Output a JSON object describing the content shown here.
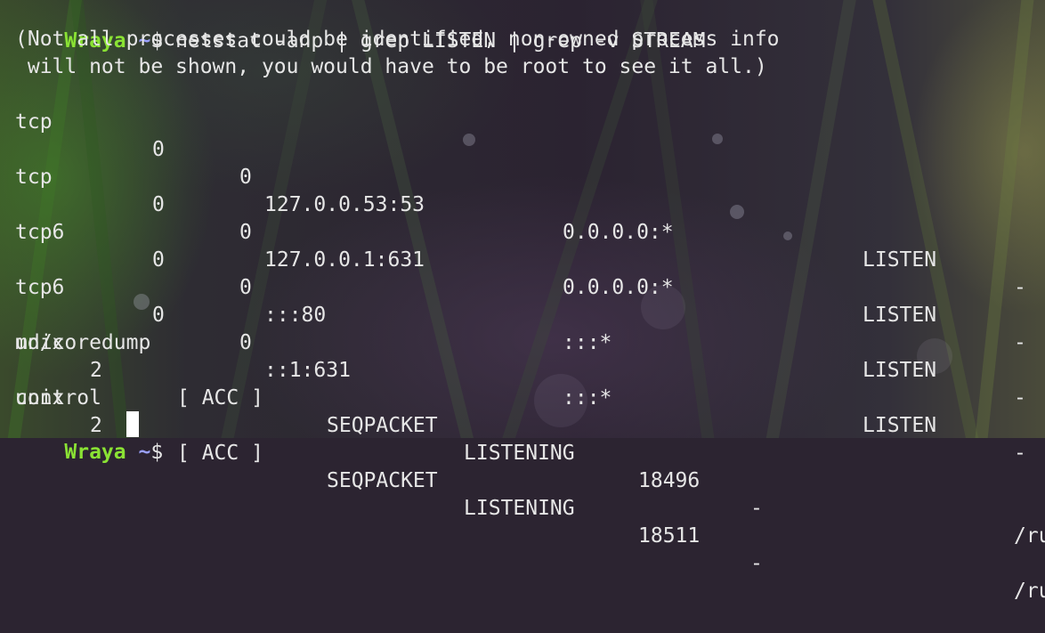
{
  "terminal": {
    "prompt": {
      "user": "Wraya",
      "path": "~",
      "symbol": "$"
    },
    "command": " netstat -anp | grep LISTEN | grep -v STREAM",
    "notice": [
      "(Not all processes could be identified, non-owned process info",
      " will not be shown, you would have to be root to see it all.)"
    ],
    "tcp_rows": [
      {
        "proto": "tcp",
        "recvq": "0",
        "sendq": "0",
        "local": "127.0.0.53:53",
        "foreign": "0.0.0.0:*",
        "state": "LISTEN",
        "pid": "-"
      },
      {
        "proto": "tcp",
        "recvq": "0",
        "sendq": "0",
        "local": "127.0.0.1:631",
        "foreign": "0.0.0.0:*",
        "state": "LISTEN",
        "pid": "-"
      },
      {
        "proto": "tcp6",
        "recvq": "0",
        "sendq": "0",
        "local": ":::80",
        "foreign": ":::*",
        "state": "LISTEN",
        "pid": "-"
      },
      {
        "proto": "tcp6",
        "recvq": "0",
        "sendq": "0",
        "local": "::1:631",
        "foreign": ":::*",
        "state": "LISTEN",
        "pid": "-"
      }
    ],
    "unix_rows": [
      {
        "proto": "unix",
        "refcnt": "2",
        "flags": "[ ACC ]",
        "type": "SEQPACKET",
        "state": "LISTENING",
        "inode": "18496",
        "pid": "-",
        "path": "/ru",
        "wrap": "md/coredump"
      },
      {
        "proto": "unix",
        "refcnt": "2",
        "flags": "[ ACC ]",
        "type": "SEQPACKET",
        "state": "LISTENING",
        "inode": "18511",
        "pid": "-",
        "path": "/ru",
        "wrap": "control"
      }
    ]
  },
  "colors": {
    "user": "#8ae234",
    "path": "#9aa0ff",
    "text": "#e6e6e6"
  }
}
